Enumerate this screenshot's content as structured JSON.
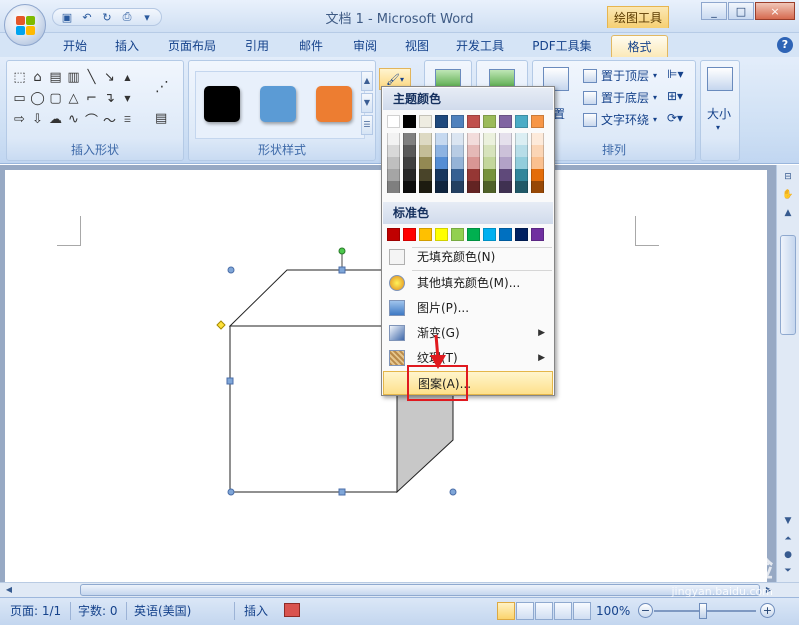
{
  "window": {
    "title": "文档 1 - Microsoft Word",
    "context_tab_group": "绘图工具",
    "controls": [
      "_",
      "□",
      "×"
    ]
  },
  "quick_access": {
    "icons": [
      "save-icon",
      "undo-icon",
      "redo-icon",
      "print-preview-icon",
      "customize-icon"
    ]
  },
  "tabs": [
    {
      "label": "开始"
    },
    {
      "label": "插入"
    },
    {
      "label": "页面布局"
    },
    {
      "label": "引用"
    },
    {
      "label": "邮件"
    },
    {
      "label": "审阅"
    },
    {
      "label": "视图"
    },
    {
      "label": "开发工具"
    },
    {
      "label": "PDF工具集"
    },
    {
      "label": "格式",
      "active": true
    }
  ],
  "ribbon": {
    "insert_shapes_label": "插入形状",
    "shape_styles_label": "形状样式",
    "arrange_label": "排列",
    "size_label": "大小",
    "style_swatches": [
      {
        "color": "#000000"
      },
      {
        "color": "#5b9bd5"
      },
      {
        "color": "#ed7d31"
      }
    ],
    "arrange_items": [
      {
        "label": "置于顶层",
        "icon": "bring-to-front-icon"
      },
      {
        "label": "置于底层",
        "icon": "send-to-back-icon"
      },
      {
        "label": "文字环绕",
        "icon": "text-wrap-icon"
      }
    ],
    "position_label": "置"
  },
  "fill_menu": {
    "theme_colors_header": "主题颜色",
    "standard_colors_header": "标准色",
    "theme_top_row": [
      "#ffffff",
      "#000000",
      "#eeece1",
      "#1f497d",
      "#4f81bd",
      "#c0504d",
      "#9bbb59",
      "#8064a2",
      "#4bacc6",
      "#f79646"
    ],
    "theme_columns": [
      [
        "#f2f2f2",
        "#d8d8d8",
        "#bfbfbf",
        "#a5a5a5",
        "#7f7f7f"
      ],
      [
        "#7f7f7f",
        "#595959",
        "#3f3f3f",
        "#262626",
        "#0c0c0c"
      ],
      [
        "#ddd9c3",
        "#c4bd97",
        "#938953",
        "#494429",
        "#1d1b10"
      ],
      [
        "#c6d9f0",
        "#8db3e2",
        "#548dd4",
        "#17365d",
        "#0f243e"
      ],
      [
        "#dbe5f1",
        "#b8cce4",
        "#95b3d7",
        "#366092",
        "#244061"
      ],
      [
        "#f2dcdb",
        "#e5b9b7",
        "#d99694",
        "#953734",
        "#632423"
      ],
      [
        "#ebf1dd",
        "#d7e3bc",
        "#c3d69b",
        "#76923c",
        "#4f6128"
      ],
      [
        "#e5e0ec",
        "#ccc1d9",
        "#b2a2c7",
        "#5f497a",
        "#3f3151"
      ],
      [
        "#dbeef3",
        "#b7dde8",
        "#92cddc",
        "#31859b",
        "#205867"
      ],
      [
        "#fdeada",
        "#fbd5b5",
        "#fac08f",
        "#e36c09",
        "#974806"
      ]
    ],
    "standard_colors": [
      "#c00000",
      "#ff0000",
      "#ffc000",
      "#ffff00",
      "#92d050",
      "#00b050",
      "#00b0f0",
      "#0070c0",
      "#002060",
      "#7030a0"
    ],
    "items": [
      {
        "label": "无填充颜色(N)",
        "icon": "no-fill-icon",
        "submenu": false
      },
      {
        "label": "其他填充颜色(M)...",
        "icon": "color-palette-icon",
        "submenu": false
      },
      {
        "label": "图片(P)...",
        "icon": "picture-icon",
        "submenu": false
      },
      {
        "label": "渐变(G)",
        "icon": "gradient-icon",
        "submenu": true
      },
      {
        "label": "纹理(T)",
        "icon": "texture-icon",
        "submenu": true
      },
      {
        "label": "图案(A)...",
        "icon": "pattern-icon",
        "submenu": false,
        "highlighted": true
      }
    ]
  },
  "status": {
    "page": "页面: 1/1",
    "words": "字数: 0",
    "language": "英语(美国)",
    "mode": "插入",
    "zoom": "100%"
  },
  "watermark": {
    "main": "Baidu经验",
    "sub": "jingyan.baidu.com"
  },
  "colors": {
    "highlight_border": "#e0191f",
    "menu_hover": "#fde08c",
    "ribbon_bg": "#cddff4"
  }
}
